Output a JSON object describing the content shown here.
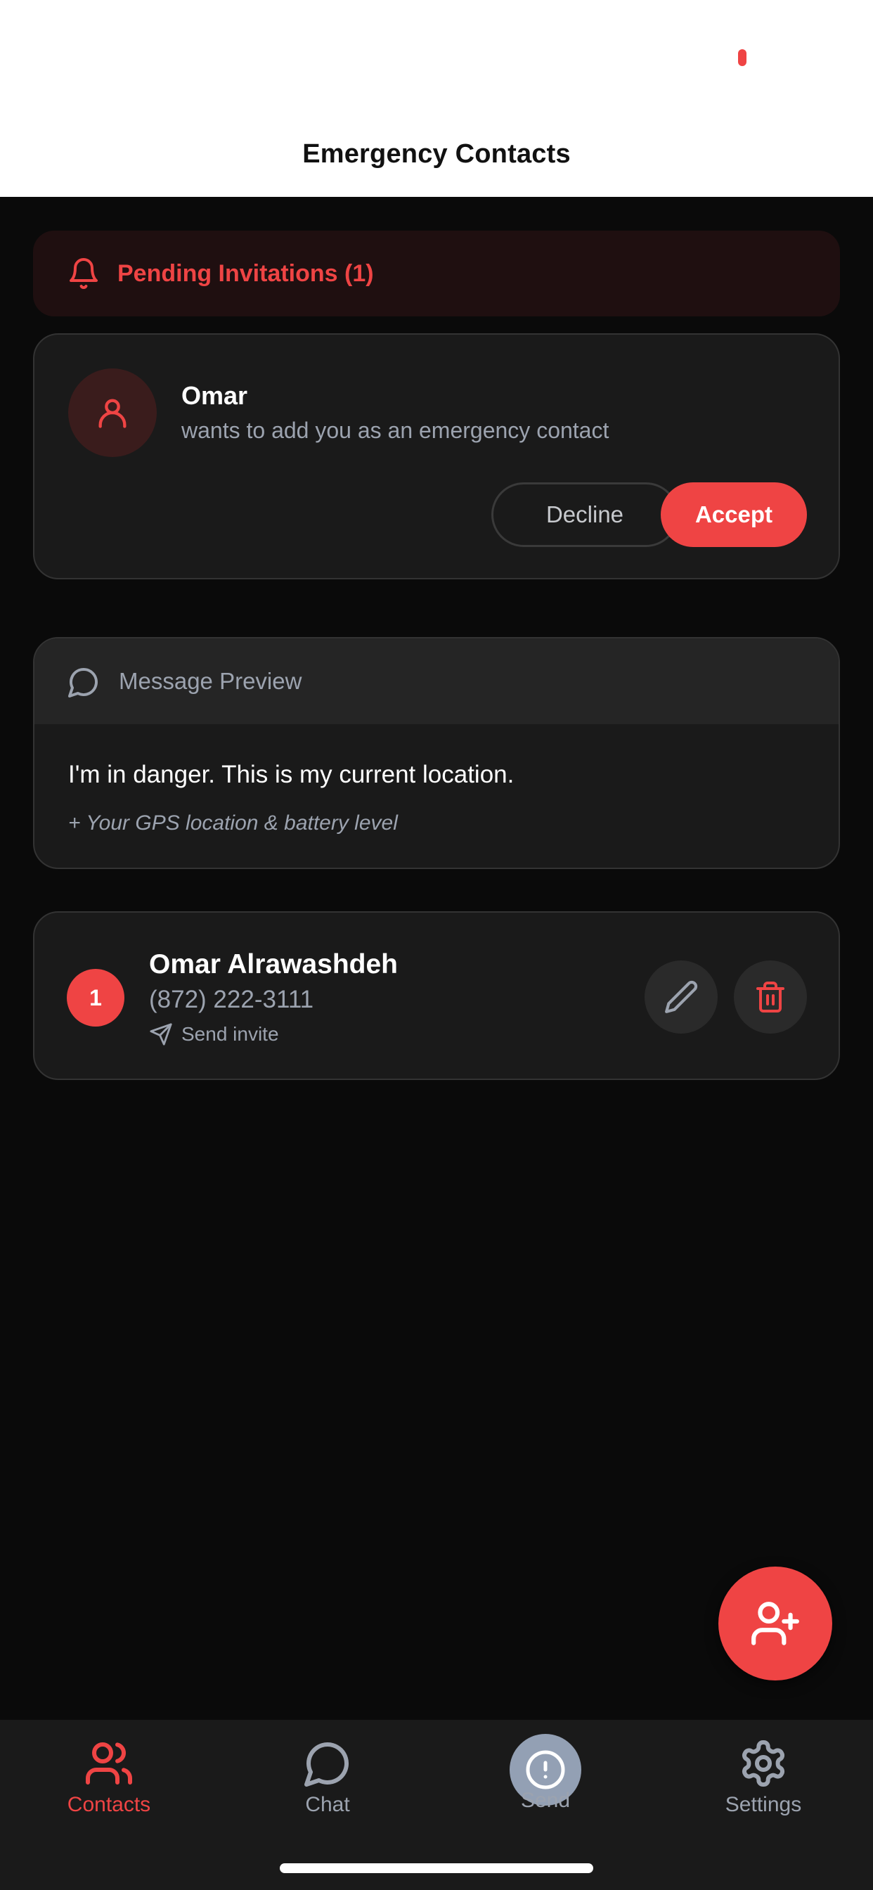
{
  "header": {
    "title": "Emergency Contacts"
  },
  "pending": {
    "label": "Pending Invitations (1)",
    "icon": "bell-icon"
  },
  "invitation": {
    "name": "Omar",
    "subtitle": "wants to add you as an emergency contact",
    "decline_label": "Decline",
    "accept_label": "Accept"
  },
  "preview": {
    "title": "Message Preview",
    "message": "I'm in danger. This is my current location.",
    "note": "+ Your GPS location & battery level"
  },
  "contacts": [
    {
      "number": "1",
      "name": "Omar Alrawashdeh",
      "phone": "(872) 222-3111",
      "invite_label": "Send invite"
    }
  ],
  "nav": {
    "contacts": "Contacts",
    "chat": "Chat",
    "send": "Send",
    "settings": "Settings"
  },
  "colors": {
    "accent": "#ef4444",
    "background": "#0a0a0a",
    "card": "#1a1a1a",
    "muted_text": "#9ca3af"
  }
}
